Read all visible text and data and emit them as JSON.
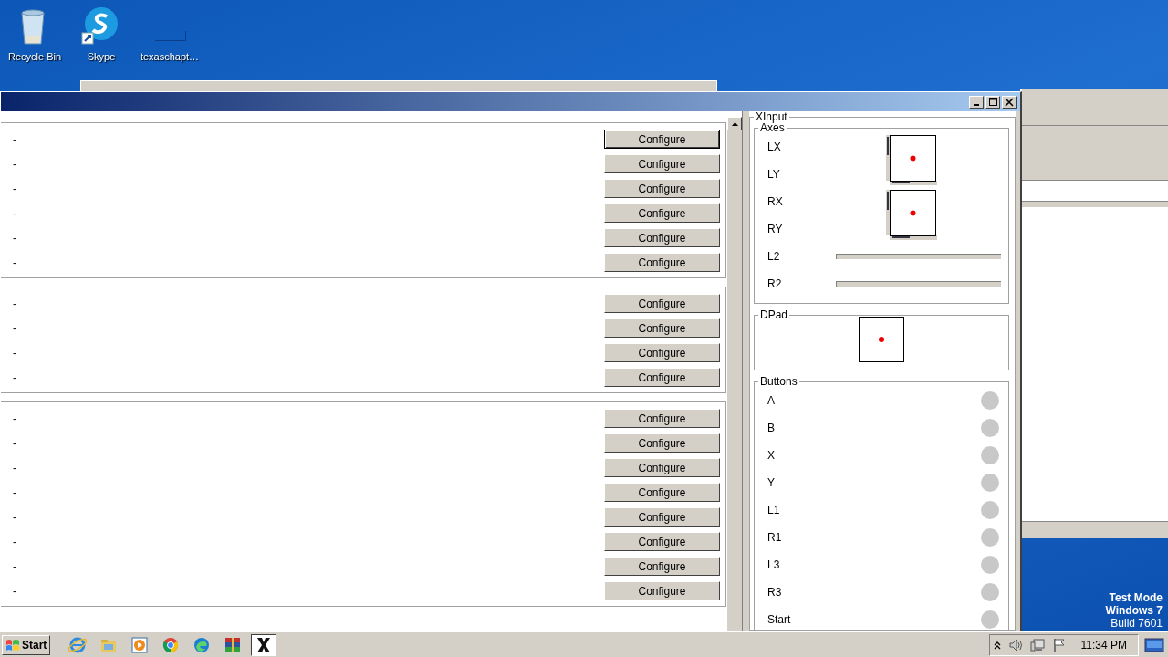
{
  "desktop_icons": [
    {
      "label": "Recycle Bin",
      "kind": "recycle"
    },
    {
      "label": "Skype",
      "kind": "skype"
    },
    {
      "label": "texaschapt…",
      "kind": "blank"
    }
  ],
  "mapping_groups": [
    {
      "rows": [
        {
          "label": "-",
          "button": "Configure",
          "focused": true
        },
        {
          "label": "-",
          "button": "Configure",
          "focused": false
        },
        {
          "label": "-",
          "button": "Configure",
          "focused": false
        },
        {
          "label": "-",
          "button": "Configure",
          "focused": false
        },
        {
          "label": "-",
          "button": "Configure",
          "focused": false
        },
        {
          "label": "-",
          "button": "Configure",
          "focused": false
        }
      ]
    },
    {
      "rows": [
        {
          "label": "-",
          "button": "Configure",
          "focused": false
        },
        {
          "label": "-",
          "button": "Configure",
          "focused": false
        },
        {
          "label": "-",
          "button": "Configure",
          "focused": false
        },
        {
          "label": "-",
          "button": "Configure",
          "focused": false
        }
      ]
    },
    {
      "rows": [
        {
          "label": "-",
          "button": "Configure",
          "focused": false
        },
        {
          "label": "-",
          "button": "Configure",
          "focused": false
        },
        {
          "label": "-",
          "button": "Configure",
          "focused": false
        },
        {
          "label": "-",
          "button": "Configure",
          "focused": false
        },
        {
          "label": "-",
          "button": "Configure",
          "focused": false
        },
        {
          "label": "-",
          "button": "Configure",
          "focused": false
        },
        {
          "label": "-",
          "button": "Configure",
          "focused": false
        },
        {
          "label": "-",
          "button": "Configure",
          "focused": false
        }
      ]
    }
  ],
  "xinput": {
    "title": "XInput",
    "axes": {
      "title": "Axes",
      "sticks": [
        {
          "labels": [
            "LX",
            "LY"
          ]
        },
        {
          "labels": [
            "RX",
            "RY"
          ]
        }
      ],
      "triggers": [
        {
          "label": "L2",
          "level": 0
        },
        {
          "label": "R2",
          "level": 0
        }
      ]
    },
    "dpad": {
      "title": "DPad"
    },
    "buttons": {
      "title": "Buttons",
      "items": [
        {
          "label": "A",
          "pressed": false
        },
        {
          "label": "B",
          "pressed": false
        },
        {
          "label": "X",
          "pressed": false
        },
        {
          "label": "Y",
          "pressed": false
        },
        {
          "label": "L1",
          "pressed": false
        },
        {
          "label": "R1",
          "pressed": false
        },
        {
          "label": "L3",
          "pressed": false
        },
        {
          "label": "R3",
          "pressed": false
        },
        {
          "label": "Start",
          "pressed": false
        }
      ]
    }
  },
  "os_notice": [
    "Test Mode",
    "Windows 7",
    "Build 7601"
  ],
  "taskbar": {
    "start": "Start",
    "apps": [
      {
        "kind": "ie",
        "selected": false
      },
      {
        "kind": "folder",
        "selected": false
      },
      {
        "kind": "media",
        "selected": false
      },
      {
        "kind": "chrome",
        "selected": false
      },
      {
        "kind": "edge",
        "selected": false
      },
      {
        "kind": "archive",
        "selected": false
      },
      {
        "kind": "xapp",
        "selected": true
      }
    ],
    "clock": "11:34 PM"
  }
}
